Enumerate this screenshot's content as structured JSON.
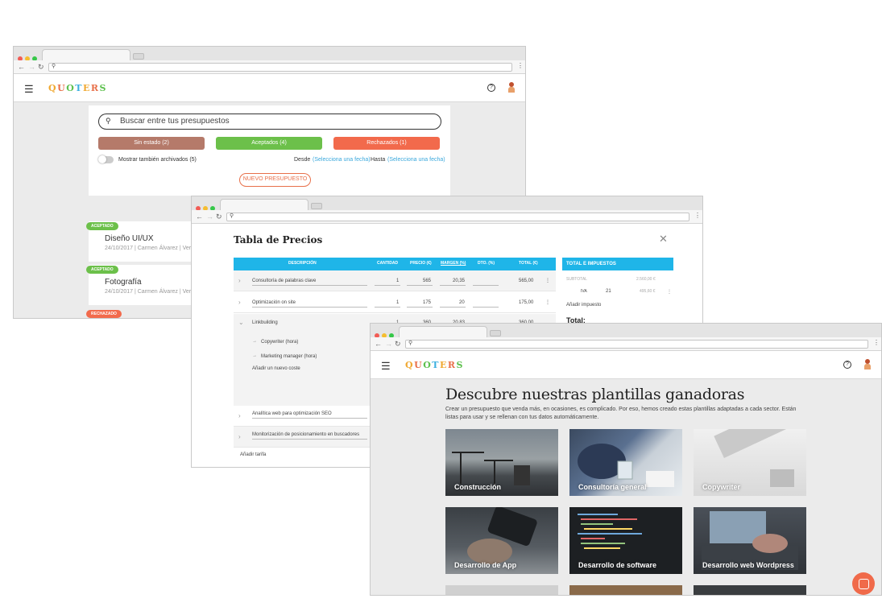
{
  "brand": {
    "letters": [
      "Q",
      "U",
      "O",
      "T",
      "E",
      "R",
      "S"
    ]
  },
  "icons": {
    "menu": "hamburger-icon",
    "help": "?",
    "back": "←",
    "forward": "→",
    "reload": "↻",
    "search": "search-icon",
    "kebab": "⋮",
    "close": "✕",
    "chevron": "›",
    "chevron_open": "⌄",
    "sub_arrow": "→"
  },
  "window1": {
    "search_placeholder": "Buscar entre tus presupuestos",
    "filters": [
      {
        "label": "Sin estado (2)",
        "color": "#b57a6a"
      },
      {
        "label": "Aceptados (4)",
        "color": "#6cc04a"
      },
      {
        "label": "Rechazados (1)",
        "color": "#f26a4c"
      }
    ],
    "show_archived": "Mostrar también archivados (5)",
    "from_label": "Desde",
    "from_value": "(Selecciona una fecha)",
    "to_label": "Hasta",
    "to_value": "(Selecciona una fecha)",
    "new_quote": "NUEVO PRESUPUESTO",
    "quotes": [
      {
        "badge": "ACEPTADO",
        "badge_color": "#6cc04a",
        "title": "Diseño UI/UX",
        "meta": "24/10/2017 | Carmen Álvarez | Ver"
      },
      {
        "badge": "ACEPTADO",
        "badge_color": "#6cc04a",
        "title": "Fotografía",
        "meta": "24/10/2017 | Carmen Álvarez | Ver"
      },
      {
        "badge": "RECHAZADO",
        "badge_color": "#f26a4c",
        "title": "",
        "meta": ""
      }
    ]
  },
  "window2": {
    "title": "Tabla de Precios",
    "columns": [
      "DESCRIPCIÓN",
      "CANTIDAD",
      "PRECIO (€)",
      "MARGEN (%)",
      "DTO. (%)",
      "TOTAL (€)"
    ],
    "rows": [
      {
        "desc": "Consultoría de palabras clave",
        "qty": "1",
        "price": "565",
        "margin": "20,35",
        "total": "565,00"
      },
      {
        "desc": "Optimización on site",
        "qty": "1",
        "price": "175",
        "margin": "20",
        "total": "175,00"
      },
      {
        "desc": "Linkbuilding",
        "qty": "1",
        "price": "360",
        "margin": "20,83",
        "total": "360,00"
      }
    ],
    "subitems": [
      "Copywriter (hora)",
      "Marketing manager (hora)"
    ],
    "add_cost": "Añadir un nuevo coste",
    "more_rows": [
      "Analítica web para optimización SEO",
      "Monitorización de posicionamiento en buscadores"
    ],
    "add_rate": "Añadir tarifa",
    "totals": {
      "header": "TOTAL E IMPUESTOS",
      "subtotal_label": "SUBTOTAL",
      "subtotal_value": "2.560,00 €",
      "tax_label": "IVA",
      "tax_rate": "21",
      "tax_value": "495,60 €",
      "add_tax": "Añadir impuesto",
      "total_label": "Total:"
    }
  },
  "window3": {
    "heading": "Descubre nuestras plantillas ganadoras",
    "lead": "Crear un presupuesto que venda más, en ocasiones, es complicado. Por eso, hemos creado estas plantillas adaptadas a cada sector. Están listas para usar y se rellenan con tus datos automáticamente.",
    "templates": [
      {
        "label": "Construcción"
      },
      {
        "label": "Consultoría general"
      },
      {
        "label": "Copywriter"
      },
      {
        "label": "Desarrollo de App"
      },
      {
        "label": "Desarrollo de software"
      },
      {
        "label": "Desarrollo web Wordpress"
      }
    ]
  }
}
